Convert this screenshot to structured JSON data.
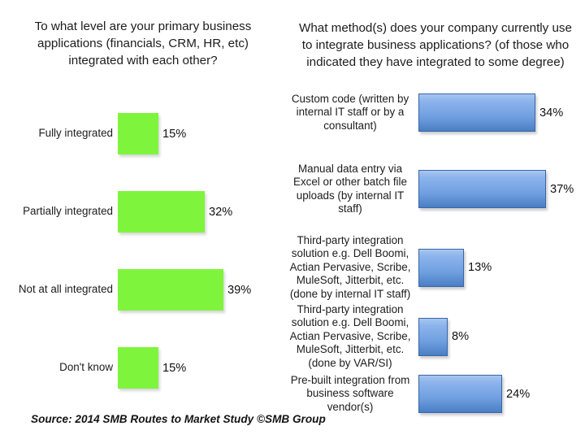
{
  "chart_data": [
    {
      "type": "bar",
      "orientation": "horizontal",
      "title": "To what level are your primary business applications (financials, CRM, HR, etc) integrated with each other?",
      "categories": [
        "Fully integrated",
        "Partially integrated",
        "Not at all integrated",
        "Don't know"
      ],
      "values": [
        15,
        32,
        39,
        15
      ],
      "value_labels": [
        "15%",
        "32%",
        "39%",
        "15%"
      ],
      "unit": "%",
      "xlabel": "",
      "ylabel": "",
      "xlim": [
        0,
        45
      ],
      "grid": false,
      "legend": "none",
      "series_color": "#7ef53c"
    },
    {
      "type": "bar",
      "orientation": "horizontal",
      "title": "What method(s) does your company currently use to integrate business applications? (of those who indicated they have integrated to some degree)",
      "categories": [
        "Custom code (written by internal IT staff or by a consultant)",
        "Manual data entry via Excel or other batch file uploads (by internal IT staff)",
        "Third-party integration solution e.g. Dell Boomi, Actian Pervasive, Scribe, MuleSoft, Jitterbit, etc. (done by internal IT staff)",
        "Third-party integration solution e.g. Dell Boomi, Actian Pervasive, Scribe, MuleSoft, Jitterbit, etc. (done by VAR/SI)",
        "Pre-built integration from business software vendor(s)"
      ],
      "values": [
        34,
        37,
        13,
        8,
        24
      ],
      "value_labels": [
        "34%",
        "37%",
        "13%",
        "8%",
        "24%"
      ],
      "unit": "%",
      "xlabel": "",
      "ylabel": "",
      "xlim": [
        0,
        40
      ],
      "grid": false,
      "legend": "none",
      "series_color": "#6f9fe0"
    }
  ],
  "footer": {
    "source": "Source: 2014 SMB Routes to Market Study ©SMB Group"
  }
}
